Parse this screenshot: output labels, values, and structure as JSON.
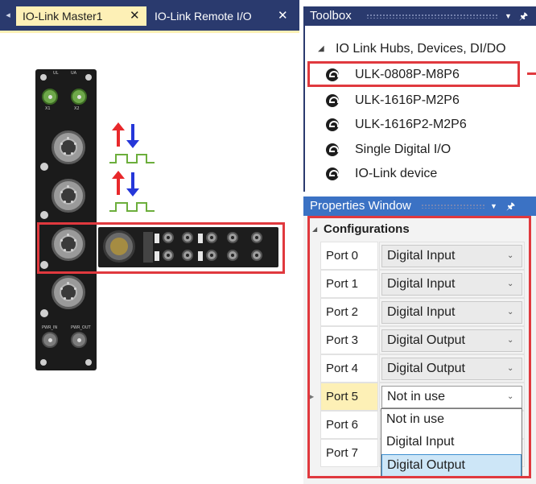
{
  "document_tabs": [
    {
      "label": "IO-Link Master1",
      "close": "✕",
      "active": true
    },
    {
      "label": "IO-Link Remote I/O",
      "close": "✕",
      "active": false
    }
  ],
  "device": {
    "labels": [
      "UL",
      "UA",
      "X1",
      "X2",
      "PWR_IN",
      "PWR_OUT"
    ]
  },
  "toolbox": {
    "title": "Toolbox",
    "group": "IO Link Hubs, Devices, DI/DO",
    "items": [
      {
        "label": "ULK-0808P-M8P6",
        "icon": "io-link-device-icon",
        "highlighted": true
      },
      {
        "label": "ULK-1616P-M2P6",
        "icon": "io-link-device-icon"
      },
      {
        "label": "ULK-1616P2-M2P6",
        "icon": "io-link-device-icon"
      },
      {
        "label": "Single Digital I/O",
        "icon": "io-link-device-icon"
      },
      {
        "label": "IO-Link device",
        "icon": "io-link-device-icon"
      }
    ]
  },
  "properties": {
    "title": "Properties Window",
    "category": "Configurations",
    "ports": [
      {
        "name": "Port 0",
        "value": "Digital Input"
      },
      {
        "name": "Port 1",
        "value": "Digital Input"
      },
      {
        "name": "Port 2",
        "value": "Digital Input"
      },
      {
        "name": "Port 3",
        "value": "Digital Output"
      },
      {
        "name": "Port 4",
        "value": "Digital Output"
      },
      {
        "name": "Port 5",
        "value": "Not in use"
      },
      {
        "name": "Port 6",
        "value": ""
      },
      {
        "name": "Port 7",
        "value": ""
      }
    ],
    "dropdown_options": [
      "Not in use",
      "Digital Input",
      "Digital Output"
    ],
    "dropdown_hover": "Digital Output"
  },
  "colors": {
    "title_bar": "#2a3a6e",
    "active_tab": "#fdf0b6",
    "properties_header": "#3b72c4",
    "highlight": "#e0393e",
    "signal_up": "#e8282b",
    "signal_down": "#2537d9",
    "signal_wave": "#6cae3c"
  }
}
